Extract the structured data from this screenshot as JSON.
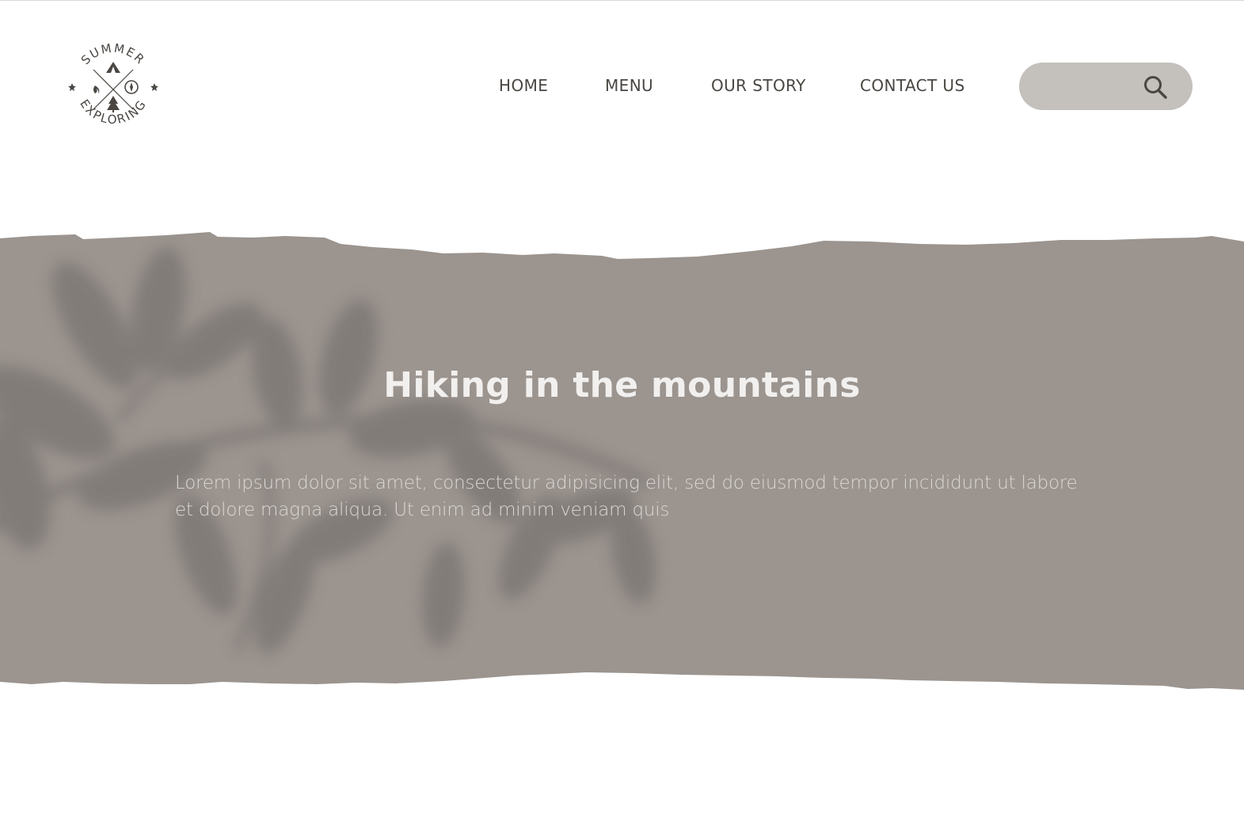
{
  "logo": {
    "top_text": "SUMMER",
    "bottom_text": "EXPLORING",
    "alt": "Summer Exploring logo"
  },
  "nav": {
    "items": [
      {
        "label": "HOME"
      },
      {
        "label": "MENU"
      },
      {
        "label": "OUR STORY"
      },
      {
        "label": "CONTACT US"
      }
    ]
  },
  "search": {
    "value": "",
    "placeholder": "",
    "icon": "search-icon"
  },
  "hero": {
    "title": "Hiking in the mountains",
    "text": "Lorem ipsum dolor sit amet, consectetur adipisicing elit, sed do eiusmod tempor incididunt ut labore et dolore magna aliqua. Ut enim ad minim veniam quis"
  },
  "colors": {
    "band": "#9b948f",
    "leaf_shadow": "#7a7470",
    "search_bg": "#c4c0bc",
    "nav_text": "#4a4642",
    "hero_title": "#f2f0ee",
    "hero_text": "#dcd8d4"
  }
}
